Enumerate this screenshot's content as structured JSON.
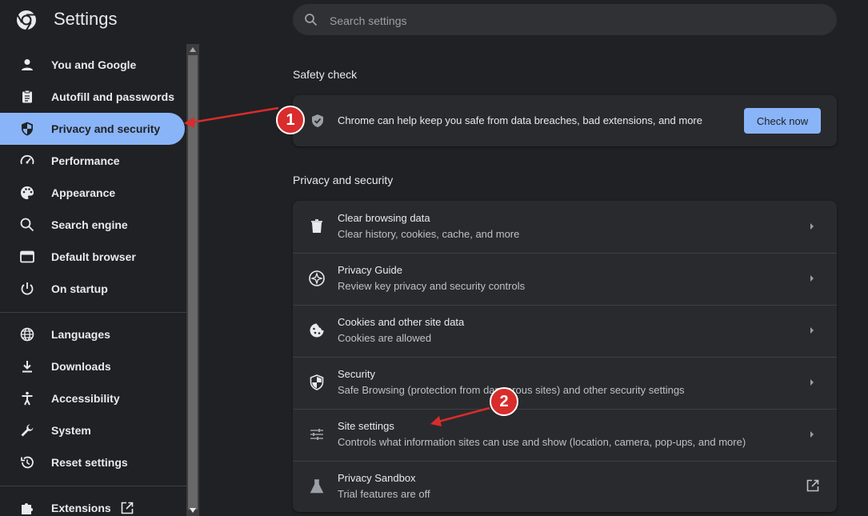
{
  "app": {
    "title": "Settings"
  },
  "search": {
    "placeholder": "Search settings",
    "value": ""
  },
  "sidebar": {
    "items": [
      {
        "label": "You and Google",
        "icon": "person-icon"
      },
      {
        "label": "Autofill and passwords",
        "icon": "clipboard-icon"
      },
      {
        "label": "Privacy and security",
        "icon": "shield-icon",
        "active": true
      },
      {
        "label": "Performance",
        "icon": "speedometer-icon"
      },
      {
        "label": "Appearance",
        "icon": "palette-icon"
      },
      {
        "label": "Search engine",
        "icon": "search-icon"
      },
      {
        "label": "Default browser",
        "icon": "browser-window-icon"
      },
      {
        "label": "On startup",
        "icon": "power-icon"
      },
      {
        "label": "Languages",
        "icon": "globe-icon"
      },
      {
        "label": "Downloads",
        "icon": "download-icon"
      },
      {
        "label": "Accessibility",
        "icon": "accessibility-icon"
      },
      {
        "label": "System",
        "icon": "wrench-icon"
      },
      {
        "label": "Reset settings",
        "icon": "history-icon"
      },
      {
        "label": "Extensions",
        "icon": "puzzle-icon",
        "external": true
      }
    ]
  },
  "safety_check": {
    "title": "Safety check",
    "text": "Chrome can help keep you safe from data breaches, bad extensions, and more",
    "button": "Check now"
  },
  "privacy": {
    "title": "Privacy and security",
    "rows": [
      {
        "title": "Clear browsing data",
        "subtitle": "Clear history, cookies, cache, and more",
        "icon": "trash-icon"
      },
      {
        "title": "Privacy Guide",
        "subtitle": "Review key privacy and security controls",
        "icon": "compass-icon"
      },
      {
        "title": "Cookies and other site data",
        "subtitle": "Cookies are allowed",
        "icon": "cookie-icon"
      },
      {
        "title": "Security",
        "subtitle": "Safe Browsing (protection from dangerous sites) and other security settings",
        "icon": "shield-icon"
      },
      {
        "title": "Site settings",
        "subtitle": "Controls what information sites can use and show (location, camera, pop-ups, and more)",
        "icon": "sliders-icon"
      },
      {
        "title": "Privacy Sandbox",
        "subtitle": "Trial features are off",
        "icon": "flask-icon",
        "external": true
      }
    ]
  },
  "annotations": [
    {
      "label": "1"
    },
    {
      "label": "2"
    }
  ],
  "colors": {
    "background": "#202124",
    "card": "#292a2d",
    "accent": "#8ab4f8",
    "annotation_red": "#d92c2c"
  }
}
